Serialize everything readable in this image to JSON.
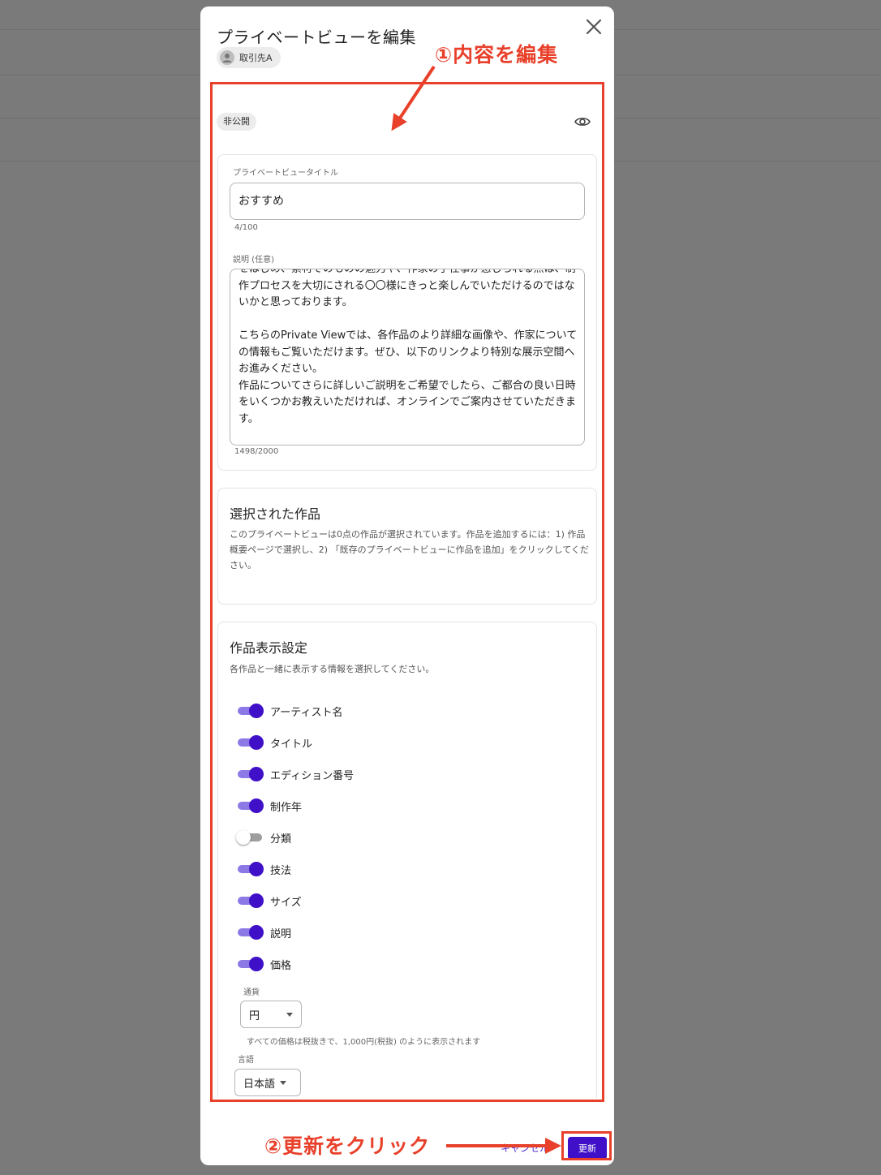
{
  "dialog": {
    "title": "プライベートビューを編集",
    "client_chip": "取引先A",
    "status_chip": "非公開"
  },
  "details": {
    "title_label": "プライベートビュータイトル",
    "title_value": "おすすめ",
    "title_counter": "4/100",
    "desc_label": "説明 (任意)",
    "desc_value": "をはじめ、素材そのものの魅力や、作家の手仕事が感じられる点は、制作プロセスを大切にされる〇〇様にきっと楽しんでいただけるのではないかと思っております。\n\nこちらのPrivate Viewでは、各作品のより詳細な画像や、作家についての情報もご覧いただけます。ぜひ、以下のリンクより特別な展示空間へお進みください。\n作品についてさらに詳しいご説明をご希望でしたら、ご都合の良い日時をいくつかお教えいただければ、オンラインでご案内させていただきます。",
    "desc_counter": "1498/2000"
  },
  "selected_works": {
    "heading": "選択された作品",
    "text": "このプライベートビューは0点の作品が選択されています。作品を追加するには：1) 作品概要ページで選択し、2) 「既存のプライベートビューに作品を追加」をクリックしてください。"
  },
  "display_settings": {
    "heading": "作品表示設定",
    "subtitle": "各作品と一緒に表示する情報を選択してください。",
    "toggles": [
      {
        "label": "アーティスト名",
        "on": true
      },
      {
        "label": "タイトル",
        "on": true
      },
      {
        "label": "エディション番号",
        "on": true
      },
      {
        "label": "制作年",
        "on": true
      },
      {
        "label": "分類",
        "on": false
      },
      {
        "label": "技法",
        "on": true
      },
      {
        "label": "サイズ",
        "on": true
      },
      {
        "label": "説明",
        "on": true
      },
      {
        "label": "価格",
        "on": true
      }
    ],
    "currency_label": "通貨",
    "currency_value": "円",
    "tax_note": "すべての価格は税抜きで、1,000円(税抜) のように表示されます",
    "language_label": "言語",
    "language_value": "日本語"
  },
  "footer": {
    "cancel_label": "キャンセル",
    "update_label": "更新"
  },
  "annotations": {
    "step1": "①内容を編集",
    "step2": "②更新をクリック",
    "color": "#e8402a"
  },
  "colors": {
    "accent": "#3f10c7",
    "toggle_track_on": "#8c79e6",
    "overlay": "#7a7a7a"
  }
}
